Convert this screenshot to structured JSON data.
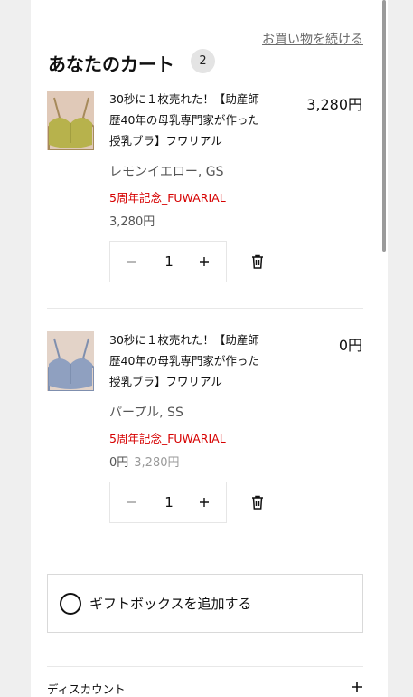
{
  "header": {
    "continue_shopping": "お買い物を続ける",
    "title": "あなたのカート",
    "item_count": "2"
  },
  "items": [
    {
      "name": "30秒に１枚売れた！【助産師歴40年の母乳専門家が作った授乳ブラ】フワリアル",
      "price": "3,280円",
      "variant": "レモンイエロー, GS",
      "promo": "5周年記念_FUWARIAL",
      "unit_price": "3,280円",
      "original_price": "",
      "quantity": "1",
      "swatch": "#b7b24c"
    },
    {
      "name": "30秒に１枚売れた！【助産師歴40年の母乳専門家が作った授乳ブラ】フワリアル",
      "price": "0円",
      "variant": "パープル, SS",
      "promo": "5周年記念_FUWARIAL",
      "unit_price": "0円",
      "original_price": "3,280円",
      "quantity": "1",
      "swatch": "#8fa0c0"
    }
  ],
  "gift": {
    "label": "ギフトボックスを追加する"
  },
  "discount": {
    "label": "ディスカウント"
  },
  "colors": {
    "promo": "#d60000",
    "accent_text": "#111111"
  }
}
